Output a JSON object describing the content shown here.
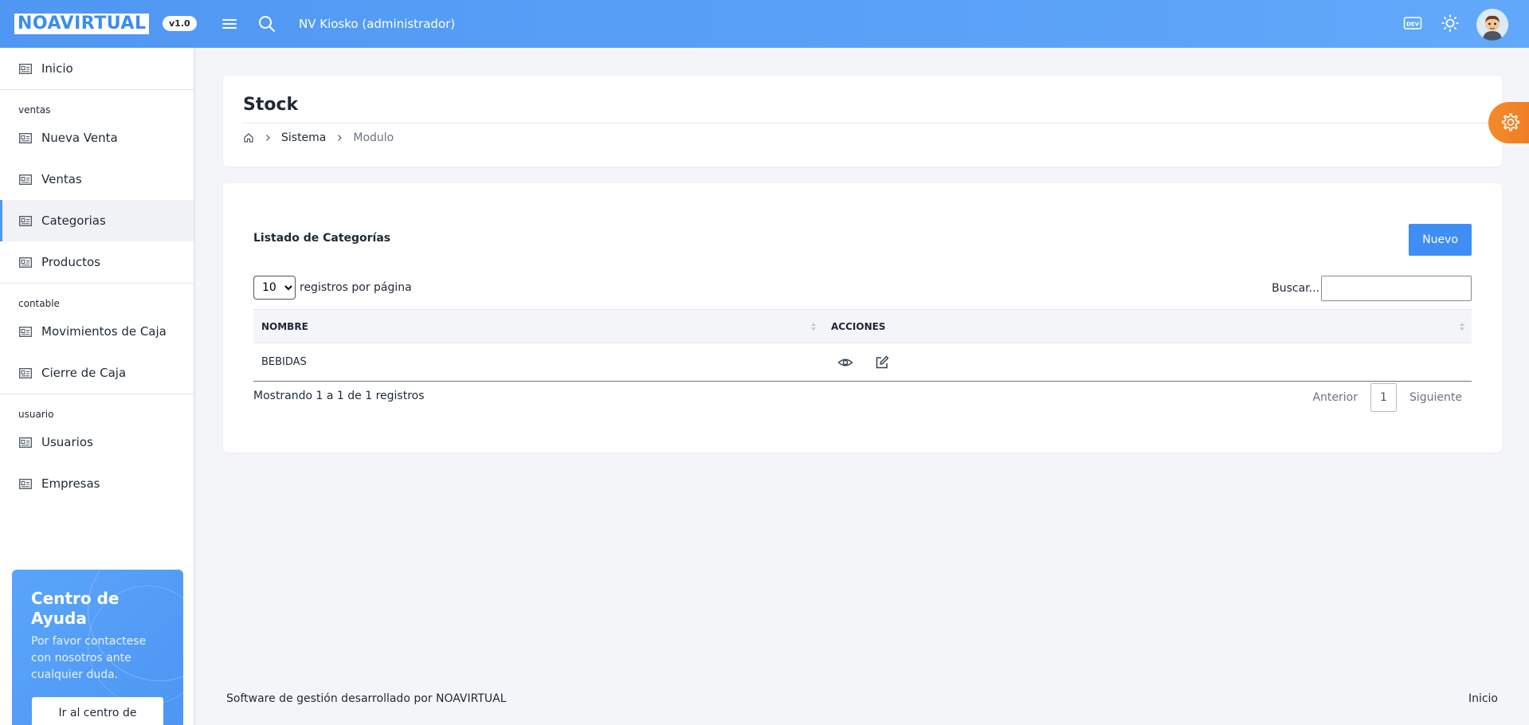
{
  "header": {
    "logo": "NOAVIRTUAL",
    "version": "v1.0",
    "app_title": "NV Kiosko (administrador)"
  },
  "sidebar": {
    "home": "Inicio",
    "sections": [
      {
        "title": "ventas",
        "items": [
          "Nueva Venta",
          "Ventas",
          "Categorias",
          "Productos"
        ]
      },
      {
        "title": "contable",
        "items": [
          "Movimientos de Caja",
          "Cierre de Caja"
        ]
      },
      {
        "title": "usuario",
        "items": [
          "Usuarios",
          "Empresas"
        ]
      }
    ],
    "active_item": "Categorias"
  },
  "help_card": {
    "title": "Centro de Ayuda",
    "text": "Por favor contactese con nosotros ante cualquier duda.",
    "button": "Ir al centro de"
  },
  "page": {
    "title": "Stock",
    "breadcrumb": [
      "Sistema",
      "Modulo"
    ]
  },
  "list": {
    "title": "Listado de Categorías",
    "new_button": "Nuevo",
    "page_length": "10",
    "page_length_options": [
      "10"
    ],
    "length_label": "registros por página",
    "search_label": "Buscar...",
    "search_value": "",
    "columns": [
      "NOMBRE",
      "ACCIONES"
    ],
    "rows": [
      {
        "nombre": "BEBIDAS"
      }
    ],
    "info": "Mostrando 1 a 1 de 1 registros",
    "prev": "Anterior",
    "current_page": "1",
    "next": "Siguiente"
  },
  "footer": {
    "left": "Software de gestión desarrollado por NOAVIRTUAL",
    "right": "Inicio"
  },
  "colors": {
    "header": "#5aa2f8",
    "accent": "#3e8ef6",
    "settings": "#f07c25"
  }
}
